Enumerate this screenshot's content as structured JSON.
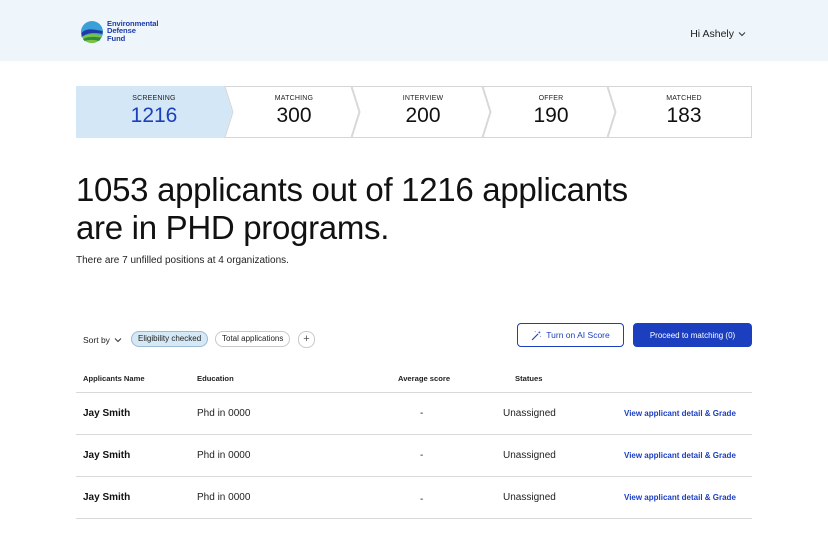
{
  "header": {
    "logo_lines": [
      "Environmental",
      "Defense",
      "Fund"
    ],
    "greeting": "Hi Ashely"
  },
  "pipeline": {
    "stages": [
      {
        "label": "SCREENING",
        "count": "1216",
        "active": true
      },
      {
        "label": "MATCHING",
        "count": "300",
        "active": false
      },
      {
        "label": "INTERVIEW",
        "count": "200",
        "active": false
      },
      {
        "label": "OFFER",
        "count": "190",
        "active": false
      },
      {
        "label": "MATCHED",
        "count": "183",
        "active": false
      }
    ]
  },
  "summary": {
    "headline": "1053 applicants out of 1216 applicants are in PHD programs.",
    "subline": "There are 7 unfilled positions at 4 organizations."
  },
  "toolbar": {
    "sort_label": "Sort by",
    "filters": [
      {
        "label": "Eligibility checked",
        "active": true
      },
      {
        "label": "Total applications",
        "active": false
      }
    ],
    "add_filter": "+",
    "ai_button": "Turn on AI Score",
    "proceed_button": "Proceed to matching (0)"
  },
  "table": {
    "columns": [
      "Applicants Name",
      "Education",
      "Average score",
      "Statues"
    ],
    "rows": [
      {
        "name": "Jay Smith",
        "education": "Phd in 0000",
        "score": "-",
        "status": "Unassigned",
        "action": "View applicant detail & Grade"
      },
      {
        "name": "Jay Smith",
        "education": "Phd in 0000",
        "score": "-",
        "status": "Unassigned",
        "action": "View applicant detail & Grade"
      },
      {
        "name": "Jay Smith",
        "education": "Phd in 0000",
        "score": "-",
        "status": "Unassigned",
        "action": "View applicant detail & Grade"
      }
    ]
  },
  "colors": {
    "accent": "#1c3fbf",
    "header_bg": "#eef6fb",
    "active_stage_bg": "#d3e7f6"
  }
}
